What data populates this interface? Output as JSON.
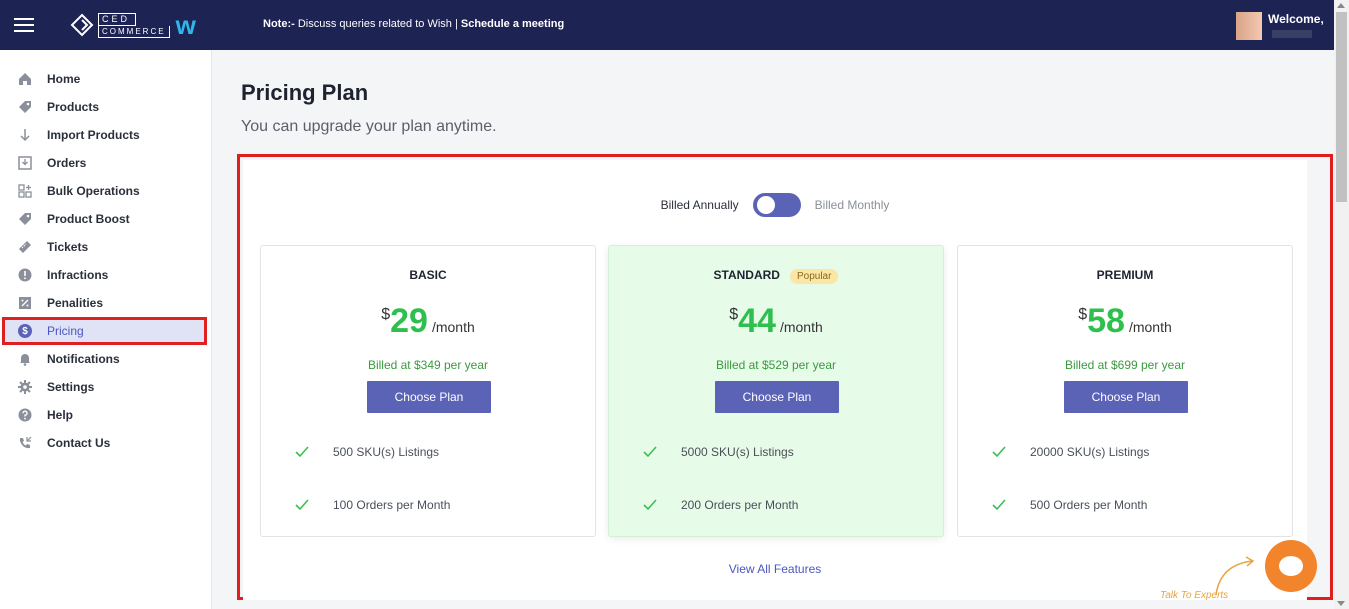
{
  "header": {
    "notice_prefix": "Note:-",
    "notice_text": " Discuss queries related to Wish | ",
    "notice_link": "Schedule a meeting",
    "welcome": "Welcome,",
    "logo_top": "CED",
    "logo_bottom": "COMMERCE",
    "brand_glyph": "w"
  },
  "sidebar": {
    "items": [
      {
        "label": "Home",
        "icon": "home-icon"
      },
      {
        "label": "Products",
        "icon": "tag-icon"
      },
      {
        "label": "Import Products",
        "icon": "arrow-down-icon"
      },
      {
        "label": "Orders",
        "icon": "inbox-download-icon"
      },
      {
        "label": "Bulk Operations",
        "icon": "grid-plus-icon"
      },
      {
        "label": "Product Boost",
        "icon": "tag-icon"
      },
      {
        "label": "Tickets",
        "icon": "ticket-icon"
      },
      {
        "label": "Infractions",
        "icon": "alert-circle-icon"
      },
      {
        "label": "Penalities",
        "icon": "percent-doc-icon"
      },
      {
        "label": "Pricing",
        "icon": "dollar-circle-icon",
        "active": true
      },
      {
        "label": "Notifications",
        "icon": "bell-icon"
      },
      {
        "label": "Settings",
        "icon": "gear-icon"
      },
      {
        "label": "Help",
        "icon": "question-circle-icon"
      },
      {
        "label": "Contact Us",
        "icon": "phone-icon"
      }
    ]
  },
  "main": {
    "title": "Pricing Plan",
    "subtitle": "You can upgrade your plan anytime.",
    "billing": {
      "annual": "Billed Annually",
      "monthly": "Billed Monthly",
      "selected": "annual"
    },
    "plans": [
      {
        "name": "BASIC",
        "currency": "$",
        "amount": "29",
        "period": "/month",
        "billed": "Billed at $349 per year",
        "cta": "Choose Plan",
        "features": [
          "500 SKU(s) Listings",
          "100 Orders per Month"
        ]
      },
      {
        "name": "STANDARD",
        "badge": "Popular",
        "currency": "$",
        "amount": "44",
        "period": "/month",
        "billed": "Billed at $529 per year",
        "cta": "Choose Plan",
        "features": [
          "5000 SKU(s) Listings",
          "200 Orders per Month"
        ]
      },
      {
        "name": "PREMIUM",
        "currency": "$",
        "amount": "58",
        "period": "/month",
        "billed": "Billed at $699 per year",
        "cta": "Choose Plan",
        "features": [
          "20000 SKU(s) Listings",
          "500 Orders per Month"
        ]
      }
    ],
    "view_all": "View All Features"
  },
  "chat": {
    "tagline": "Talk To Experts"
  },
  "colors": {
    "topbar": "#1d2353",
    "accent": "#5b63b7",
    "price": "#2fbf4f",
    "highlight": "#e01e1e",
    "chat": "#f2852c"
  }
}
